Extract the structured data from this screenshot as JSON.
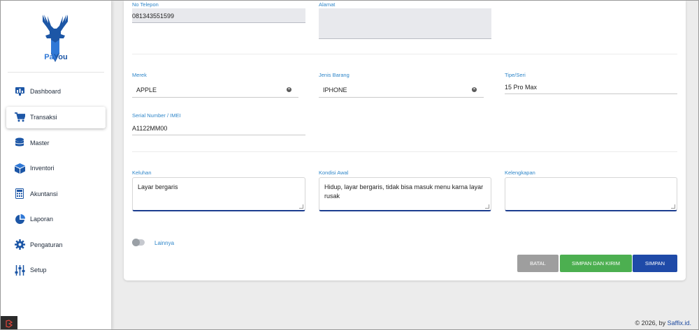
{
  "brand": {
    "name_part1": "Pa",
    "name_part2": "You",
    "color": "#1c56a6"
  },
  "sidebar": {
    "items": [
      {
        "label": "Dashboard",
        "icon": "dashboard-icon"
      },
      {
        "label": "Transaksi",
        "icon": "cart-icon",
        "active": true
      },
      {
        "label": "Master",
        "icon": "database-icon"
      },
      {
        "label": "Inventori",
        "icon": "box-icon"
      },
      {
        "label": "Akuntansi",
        "icon": "calculator-icon"
      },
      {
        "label": "Laporan",
        "icon": "pie-chart-icon"
      },
      {
        "label": "Pengaturan",
        "icon": "gear-icon"
      },
      {
        "label": "Setup",
        "icon": "sliders-icon"
      }
    ]
  },
  "form": {
    "phone": {
      "label": "No Telepon",
      "value": "081343551599"
    },
    "address": {
      "label": "Alamat",
      "value": ""
    },
    "brand": {
      "label": "Merek",
      "value": "APPLE"
    },
    "item_type": {
      "label": "Jenis Barang",
      "value": "IPHONE"
    },
    "model": {
      "label": "Tipe/Seri",
      "value": "15 Pro Max"
    },
    "serial": {
      "label": "Serial Number / IMEI",
      "value": "A1122MM00"
    },
    "complaint": {
      "label": "Keluhan",
      "value": "Layar bergaris"
    },
    "initial_condition": {
      "label": "Kondisi Awal",
      "value": "Hidup, layar bergaris, tidak bisa masuk menu karna layar rusak"
    },
    "accessories": {
      "label": "Kelengkapan",
      "value": ""
    },
    "other_toggle": {
      "label": "Lainnya",
      "checked": false
    }
  },
  "buttons": {
    "cancel": "BATAL",
    "save_send": "SIMPAN DAN KIRIM",
    "save": "SIMPAN"
  },
  "footer": {
    "text": "© 2026, by ",
    "link": "Saffix.id."
  },
  "colors": {
    "accent": "#1f4aa8",
    "label": "#2f86c9",
    "success": "#4caf50",
    "neutral": "#9e9e9e"
  }
}
